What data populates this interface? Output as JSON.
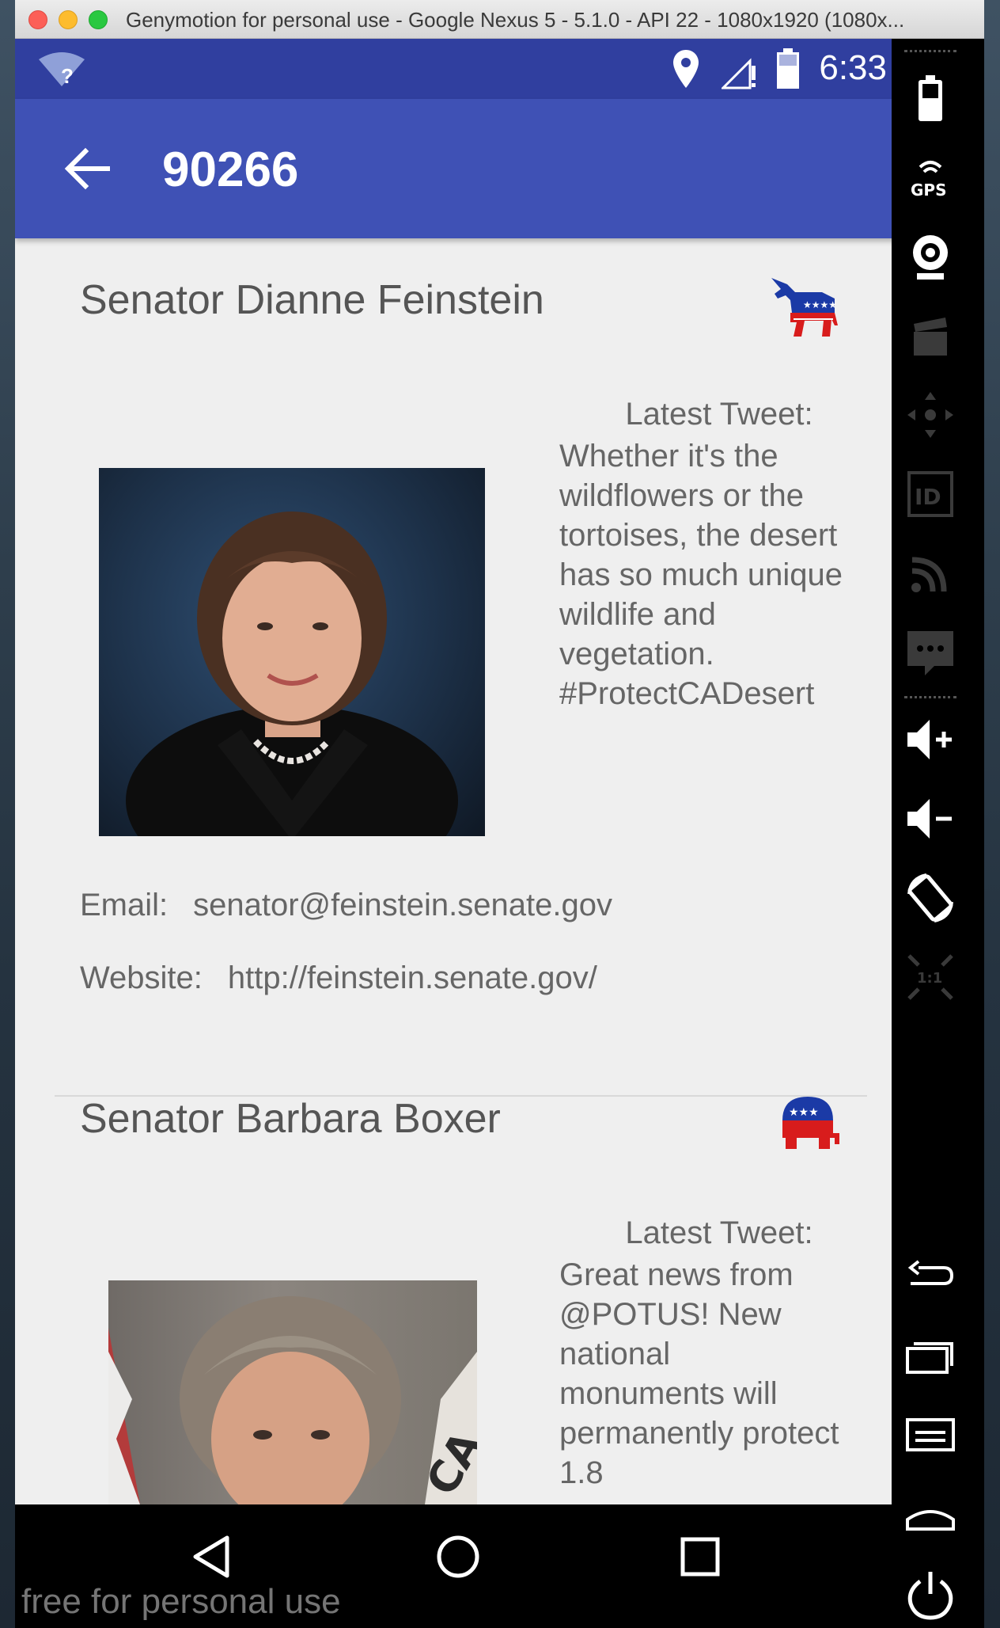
{
  "window": {
    "title": "Genymotion for personal use - Google Nexus 5 - 5.1.0 - API 22 - 1080x1920 (1080x..."
  },
  "status_bar": {
    "time": "6:33"
  },
  "app_bar": {
    "title": "90266"
  },
  "representatives": [
    {
      "name": "Senator Dianne Feinstein",
      "party_icon": "democrat-donkey-icon",
      "tweet_label": "Latest Tweet:",
      "tweet": "Whether it's the wildflowers or the tortoises, the desert has so much unique wildlife and vegetation. #ProtectCADesert",
      "email_label": "Email:",
      "email": "senator@feinstein.senate.gov",
      "website_label": "Website:",
      "website": "http://feinstein.senate.gov/"
    },
    {
      "name": "Senator Barbara Boxer",
      "party_icon": "republican-elephant-icon",
      "tweet_label": "Latest Tweet:",
      "tweet": "Great news from @POTUS! New national monuments will permanently protect 1.8"
    }
  ],
  "watermark": "free for personal use",
  "colors": {
    "status_bar": "#303f9f",
    "app_bar": "#3f51b5",
    "background": "#efefef",
    "democrat_blue": "#1b3aa6",
    "republican_red": "#d81c1c"
  }
}
